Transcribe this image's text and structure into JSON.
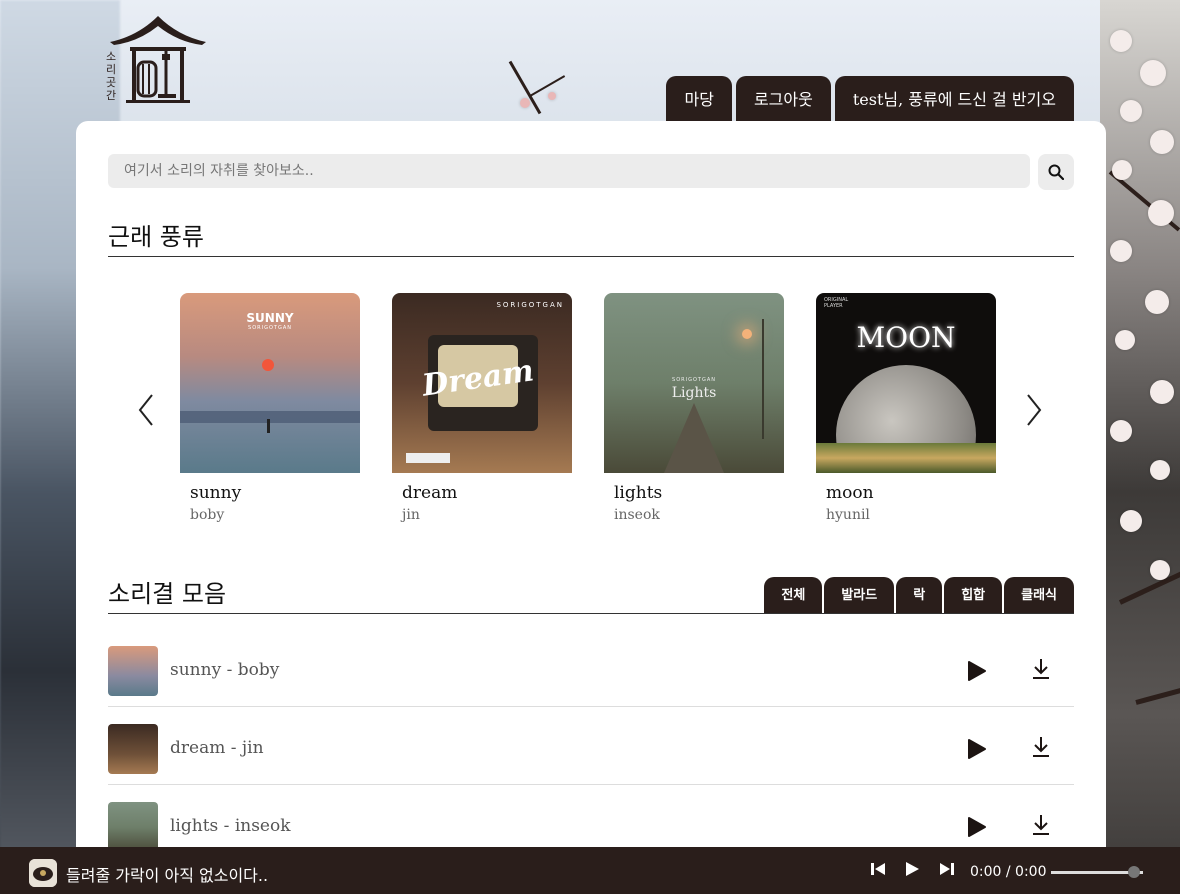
{
  "logo": {
    "text": "소리곳간"
  },
  "nav": {
    "items": [
      {
        "label": "마당"
      },
      {
        "label": "로그아웃"
      },
      {
        "label": "test님, 풍류에 드신 걸 반기오"
      }
    ]
  },
  "search": {
    "placeholder": "여기서 소리의 자취를 찾아보소.."
  },
  "recent": {
    "title": "근래 풍류",
    "albums": [
      {
        "title": "sunny",
        "artist": "boby",
        "cover_text": "SUNNY",
        "cover_sub": "SORIGOTGAN"
      },
      {
        "title": "dream",
        "artist": "jin",
        "cover_text": "Dream",
        "cover_sub": "SORIGOTGAN"
      },
      {
        "title": "lights",
        "artist": "inseok",
        "cover_text": "Lights",
        "cover_sub": "SORIGOTGAN"
      },
      {
        "title": "moon",
        "artist": "hyunil",
        "cover_text": "MOON",
        "cover_sub": "ORIGINAL PLAYER"
      }
    ]
  },
  "collection": {
    "title": "소리결 모음",
    "genres": [
      {
        "label": "전체"
      },
      {
        "label": "발라드"
      },
      {
        "label": "락"
      },
      {
        "label": "힙합"
      },
      {
        "label": "클래식"
      }
    ],
    "tracks": [
      {
        "label": "sunny - boby"
      },
      {
        "label": "dream - jin"
      },
      {
        "label": "lights - inseok"
      }
    ]
  },
  "player": {
    "status": "들려줄 가락이 아직 없소이다..",
    "time": "0:00 / 0:00",
    "volume": 0.9
  },
  "icons": {
    "search": "search-icon",
    "prev": "chevron-left-icon",
    "next": "chevron-right-icon",
    "play": "play-icon",
    "download": "download-icon",
    "skip_back": "skip-back-icon",
    "skip_forward": "skip-forward-icon"
  },
  "colors": {
    "accent": "#2a1e1b",
    "card": "#ffffff"
  }
}
